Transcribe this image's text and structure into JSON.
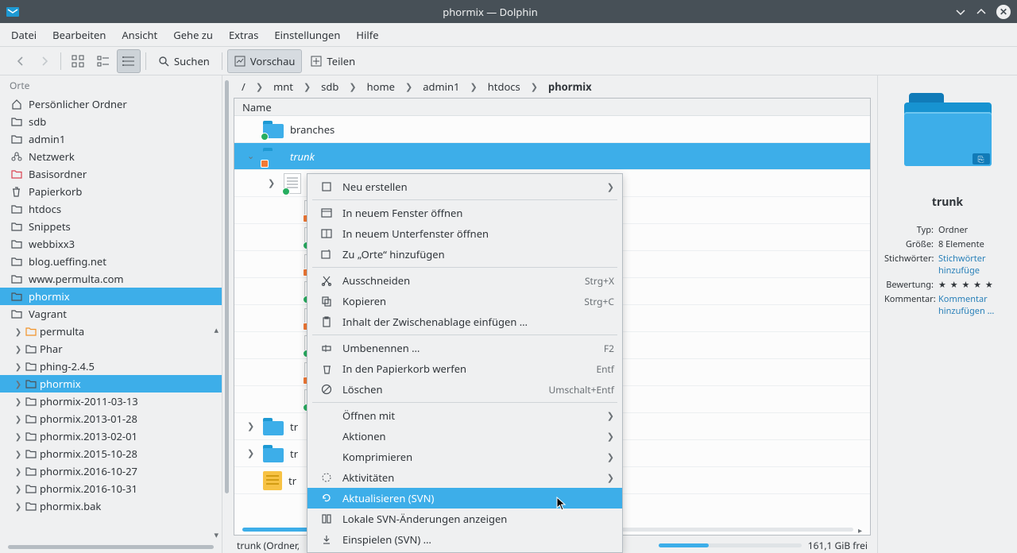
{
  "window": {
    "title": "phormix — Dolphin"
  },
  "menubar": [
    "Datei",
    "Bearbeiten",
    "Ansicht",
    "Gehe zu",
    "Extras",
    "Einstellungen",
    "Hilfe"
  ],
  "toolbar": {
    "search": "Suchen",
    "preview": "Vorschau",
    "share": "Teilen"
  },
  "sidebar": {
    "header": "Orte",
    "places": [
      {
        "label": "Persönlicher Ordner",
        "icon": "home"
      },
      {
        "label": "sdb",
        "icon": "folder"
      },
      {
        "label": "admin1",
        "icon": "folder"
      },
      {
        "label": "Netzwerk",
        "icon": "network"
      },
      {
        "label": "Basisordner",
        "icon": "folder-red"
      },
      {
        "label": "Papierkorb",
        "icon": "trash"
      },
      {
        "label": "htdocs",
        "icon": "folder"
      },
      {
        "label": "Snippets",
        "icon": "folder"
      },
      {
        "label": "webbixx3",
        "icon": "folder"
      },
      {
        "label": "blog.ueffing.net",
        "icon": "folder"
      },
      {
        "label": "www.permulta.com",
        "icon": "folder"
      },
      {
        "label": "phormix",
        "icon": "folder",
        "selected": true
      },
      {
        "label": "Vagrant",
        "icon": "folder"
      }
    ],
    "tree": [
      {
        "label": "permulta",
        "color": "#f29429"
      },
      {
        "label": "Phar"
      },
      {
        "label": "phing-2.4.5"
      },
      {
        "label": "phormix",
        "selected": true
      },
      {
        "label": "phormix-2011-03-13"
      },
      {
        "label": "phormix.2013-01-28"
      },
      {
        "label": "phormix.2013-02-01"
      },
      {
        "label": "phormix.2015-10-28"
      },
      {
        "label": "phormix.2016-10-27"
      },
      {
        "label": "phormix.2016-10-31"
      },
      {
        "label": "phormix.bak"
      }
    ]
  },
  "breadcrumbs": [
    "/",
    "mnt",
    "sdb",
    "home",
    "admin1",
    "htdocs",
    "phormix"
  ],
  "fileview": {
    "header": "Name",
    "rows": [
      {
        "type": "folder",
        "label": "branches",
        "indent": 0,
        "badge": "ok"
      },
      {
        "type": "folder",
        "label": "trunk",
        "indent": 0,
        "selected": true,
        "expanded": true,
        "badge": "link"
      },
      {
        "type": "doc",
        "label": "",
        "indent": 1,
        "expandable": true,
        "badge": "ok"
      },
      {
        "type": "doc",
        "label": "",
        "indent": 2,
        "badge": "link"
      },
      {
        "type": "doc",
        "label": "",
        "indent": 2,
        "badge": "ok"
      },
      {
        "type": "doc",
        "label": "",
        "indent": 2,
        "badge": "link"
      },
      {
        "type": "doc",
        "label": "",
        "indent": 2,
        "badge": "ok"
      },
      {
        "type": "doc",
        "label": "",
        "indent": 2,
        "badge": "link"
      },
      {
        "type": "doc",
        "label": "",
        "indent": 2,
        "badge": "ok"
      },
      {
        "type": "doc",
        "label": "",
        "indent": 2,
        "badge": "link"
      },
      {
        "type": "doc",
        "label": "",
        "indent": 2,
        "badge": "ok"
      },
      {
        "type": "folder",
        "label": "tr",
        "indent": 0,
        "expandable": true
      },
      {
        "type": "folder",
        "label": "tr",
        "indent": 0,
        "expandable": true
      },
      {
        "type": "note",
        "label": "tr",
        "indent": 0
      }
    ]
  },
  "contextmenu": [
    {
      "label": "Neu erstellen",
      "icon": "new",
      "submenu": true
    },
    {
      "sep": true
    },
    {
      "label": "In neuem Fenster öffnen",
      "icon": "window"
    },
    {
      "label": "In neuem Unterfenster öffnen",
      "icon": "panel"
    },
    {
      "label": "Zu „Orte“ hinzufügen",
      "icon": "add-place"
    },
    {
      "sep": true
    },
    {
      "label": "Ausschneiden",
      "icon": "cut",
      "shortcut": "Strg+X"
    },
    {
      "label": "Kopieren",
      "icon": "copy",
      "shortcut": "Strg+C"
    },
    {
      "label": "Inhalt der Zwischenablage einfügen …",
      "icon": "paste"
    },
    {
      "sep": true
    },
    {
      "label": "Umbenennen …",
      "icon": "rename",
      "shortcut": "F2"
    },
    {
      "label": "In den Papierkorb werfen",
      "icon": "trash",
      "shortcut": "Entf"
    },
    {
      "label": "Löschen",
      "icon": "delete",
      "shortcut": "Umschalt+Entf"
    },
    {
      "sep": true
    },
    {
      "label": "Öffnen mit",
      "submenu": true
    },
    {
      "label": "Aktionen",
      "submenu": true
    },
    {
      "label": "Komprimieren",
      "submenu": true
    },
    {
      "label": "Aktivitäten",
      "icon": "dotted",
      "submenu": true
    },
    {
      "label": "Aktualisieren (SVN)",
      "icon": "refresh",
      "highlight": true
    },
    {
      "label": "Lokale SVN-Änderungen anzeigen",
      "icon": "diff"
    },
    {
      "label": "Einspielen (SVN) …",
      "icon": "commit"
    }
  ],
  "info": {
    "title": "trunk",
    "rows": {
      "typ_k": "Typ:",
      "typ_v": "Ordner",
      "size_k": "Größe:",
      "size_v": "8 Elemente",
      "tags_k": "Stichwörter:",
      "tags_v": "Stichwörter hinzufüge",
      "rating_k": "Bewertung:",
      "rating_v": "★ ★ ★ ★ ★",
      "comment_k": "Kommentar:",
      "comment_v": "Kommentar hinzufügen …"
    }
  },
  "status": {
    "text": "trunk (Ordner,",
    "free": "161,1 GiB frei"
  }
}
